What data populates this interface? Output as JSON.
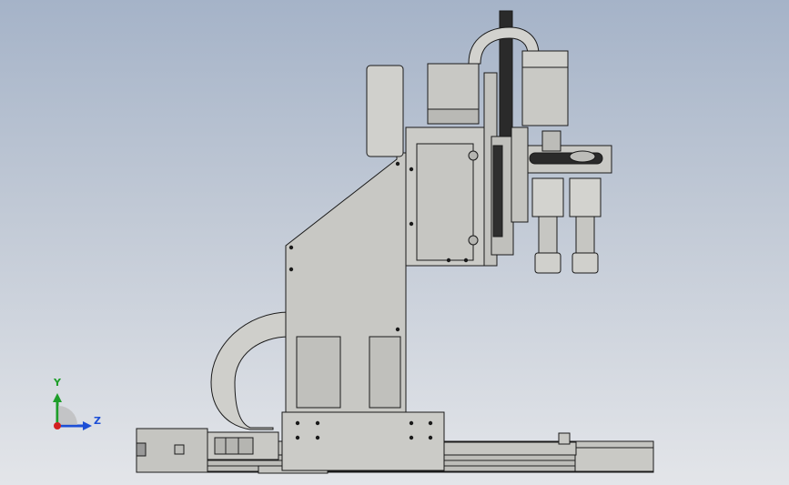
{
  "viewport": {
    "background_top": "#a5b3c8",
    "background_bottom": "#e3e5e9"
  },
  "model": {
    "part_color": "#c8c8c4",
    "edge_color": "#1a1a1a",
    "dark_color": "#2a2a2a"
  },
  "triad": {
    "y_label": "Y",
    "z_label": "Z",
    "y_color": "#1e9e2a",
    "z_color": "#1d4fd6",
    "x_color": "#d22020"
  }
}
